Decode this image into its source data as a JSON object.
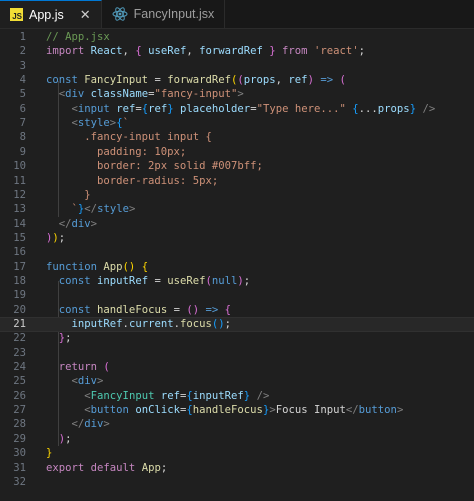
{
  "tabs": [
    {
      "label": "App.js",
      "icon": "js-file-icon",
      "badge": "JS",
      "active": true
    },
    {
      "label": "FancyInput.jsx",
      "icon": "react-icon",
      "active": false
    }
  ],
  "accent": "#0078d4",
  "code_lines": [
    {
      "n": "1",
      "tokens": [
        [
          "// App.jsx",
          "t-com"
        ]
      ]
    },
    {
      "n": "2",
      "tokens": [
        [
          "import ",
          "t-ctrl"
        ],
        [
          "React",
          "t-var"
        ],
        [
          ", ",
          "t-pun"
        ],
        [
          "{ ",
          "t-b2"
        ],
        [
          "useRef",
          "t-var"
        ],
        [
          ", ",
          "t-pun"
        ],
        [
          "forwardRef",
          "t-var"
        ],
        [
          " }",
          "t-b2"
        ],
        [
          " from ",
          "t-ctrl"
        ],
        [
          "'react'",
          "t-str"
        ],
        [
          ";",
          "t-pun"
        ]
      ]
    },
    {
      "n": "3",
      "tokens": []
    },
    {
      "n": "4",
      "tokens": [
        [
          "const ",
          "t-key"
        ],
        [
          "FancyInput",
          "t-fn"
        ],
        [
          " = ",
          "t-pun"
        ],
        [
          "forwardRef",
          "t-fn"
        ],
        [
          "(",
          "t-b1"
        ],
        [
          "(",
          "t-b2"
        ],
        [
          "props",
          "t-var"
        ],
        [
          ", ",
          "t-pun"
        ],
        [
          "ref",
          "t-var"
        ],
        [
          ")",
          "t-b2"
        ],
        [
          " => ",
          "t-key"
        ],
        [
          "(",
          "t-b2"
        ]
      ]
    },
    {
      "n": "5",
      "tokens": [
        [
          "  ",
          "t-pun"
        ],
        [
          "<",
          "t-brk"
        ],
        [
          "div ",
          "t-tag"
        ],
        [
          "className",
          "t-attr"
        ],
        [
          "=",
          "t-pun"
        ],
        [
          "\"fancy-input\"",
          "t-str"
        ],
        [
          ">",
          "t-brk"
        ]
      ]
    },
    {
      "n": "6",
      "tokens": [
        [
          "    ",
          "t-pun"
        ],
        [
          "<",
          "t-brk"
        ],
        [
          "input ",
          "t-tag"
        ],
        [
          "ref",
          "t-attr"
        ],
        [
          "=",
          "t-pun"
        ],
        [
          "{",
          "t-b3"
        ],
        [
          "ref",
          "t-var"
        ],
        [
          "}",
          "t-b3"
        ],
        [
          " placeholder",
          "t-attr"
        ],
        [
          "=",
          "t-pun"
        ],
        [
          "\"Type here...\"",
          "t-str"
        ],
        [
          " ",
          "t-pun"
        ],
        [
          "{",
          "t-b3"
        ],
        [
          "...",
          "t-pun"
        ],
        [
          "props",
          "t-var"
        ],
        [
          "}",
          "t-b3"
        ],
        [
          " />",
          "t-brk"
        ]
      ]
    },
    {
      "n": "7",
      "tokens": [
        [
          "    ",
          "t-pun"
        ],
        [
          "<",
          "t-brk"
        ],
        [
          "style",
          "t-tag"
        ],
        [
          ">",
          "t-brk"
        ],
        [
          "{",
          "t-b3"
        ],
        [
          "`",
          "t-str"
        ]
      ]
    },
    {
      "n": "8",
      "tokens": [
        [
          "      .fancy-input input {",
          "t-css"
        ]
      ]
    },
    {
      "n": "9",
      "tokens": [
        [
          "        padding: 10px;",
          "t-css"
        ]
      ]
    },
    {
      "n": "10",
      "tokens": [
        [
          "        border: 2px solid #007bff;",
          "t-css"
        ]
      ]
    },
    {
      "n": "11",
      "tokens": [
        [
          "        border-radius: 5px;",
          "t-css"
        ]
      ]
    },
    {
      "n": "12",
      "tokens": [
        [
          "      }",
          "t-css"
        ]
      ]
    },
    {
      "n": "13",
      "tokens": [
        [
          "    ",
          "t-pun"
        ],
        [
          "`",
          "t-str"
        ],
        [
          "}",
          "t-b3"
        ],
        [
          "</",
          "t-brk"
        ],
        [
          "style",
          "t-tag"
        ],
        [
          ">",
          "t-brk"
        ]
      ]
    },
    {
      "n": "14",
      "tokens": [
        [
          "  ",
          "t-pun"
        ],
        [
          "</",
          "t-brk"
        ],
        [
          "div",
          "t-tag"
        ],
        [
          ">",
          "t-brk"
        ]
      ]
    },
    {
      "n": "15",
      "tokens": [
        [
          ")",
          "t-b2"
        ],
        [
          ")",
          "t-b1"
        ],
        [
          ";",
          "t-pun"
        ]
      ]
    },
    {
      "n": "16",
      "tokens": []
    },
    {
      "n": "17",
      "tokens": [
        [
          "function ",
          "t-key"
        ],
        [
          "App",
          "t-fn"
        ],
        [
          "()",
          "t-b1"
        ],
        [
          " ",
          "t-pun"
        ],
        [
          "{",
          "t-b1"
        ]
      ]
    },
    {
      "n": "18",
      "tokens": [
        [
          "  ",
          "t-pun"
        ],
        [
          "const ",
          "t-key"
        ],
        [
          "inputRef",
          "t-var"
        ],
        [
          " = ",
          "t-pun"
        ],
        [
          "useRef",
          "t-fn"
        ],
        [
          "(",
          "t-b2"
        ],
        [
          "null",
          "t-key"
        ],
        [
          ")",
          "t-b2"
        ],
        [
          ";",
          "t-pun"
        ]
      ]
    },
    {
      "n": "19",
      "tokens": []
    },
    {
      "n": "20",
      "tokens": [
        [
          "  ",
          "t-pun"
        ],
        [
          "const ",
          "t-key"
        ],
        [
          "handleFocus",
          "t-fn"
        ],
        [
          " = ",
          "t-pun"
        ],
        [
          "()",
          "t-b2"
        ],
        [
          " => ",
          "t-key"
        ],
        [
          "{",
          "t-b2"
        ]
      ]
    },
    {
      "n": "21",
      "tokens": [
        [
          "    ",
          "t-pun"
        ],
        [
          "inputRef",
          "t-var"
        ],
        [
          ".",
          "t-pun"
        ],
        [
          "current",
          "t-var"
        ],
        [
          ".",
          "t-pun"
        ],
        [
          "focus",
          "t-fn"
        ],
        [
          "()",
          "t-b3"
        ],
        [
          ";",
          "t-pun"
        ]
      ]
    },
    {
      "n": "22",
      "tokens": [
        [
          "  ",
          "t-pun"
        ],
        [
          "}",
          "t-b2"
        ],
        [
          ";",
          "t-pun"
        ]
      ]
    },
    {
      "n": "23",
      "tokens": []
    },
    {
      "n": "24",
      "tokens": [
        [
          "  ",
          "t-pun"
        ],
        [
          "return ",
          "t-ctrl"
        ],
        [
          "(",
          "t-b2"
        ]
      ]
    },
    {
      "n": "25",
      "tokens": [
        [
          "    ",
          "t-pun"
        ],
        [
          "<",
          "t-brk"
        ],
        [
          "div",
          "t-tag"
        ],
        [
          ">",
          "t-brk"
        ]
      ]
    },
    {
      "n": "26",
      "tokens": [
        [
          "      ",
          "t-pun"
        ],
        [
          "<",
          "t-brk"
        ],
        [
          "FancyInput ",
          "t-cmp"
        ],
        [
          "ref",
          "t-attr"
        ],
        [
          "=",
          "t-pun"
        ],
        [
          "{",
          "t-b3"
        ],
        [
          "inputRef",
          "t-var"
        ],
        [
          "}",
          "t-b3"
        ],
        [
          " />",
          "t-brk"
        ]
      ]
    },
    {
      "n": "27",
      "tokens": [
        [
          "      ",
          "t-pun"
        ],
        [
          "<",
          "t-brk"
        ],
        [
          "button ",
          "t-tag"
        ],
        [
          "onClick",
          "t-attr"
        ],
        [
          "=",
          "t-pun"
        ],
        [
          "{",
          "t-b3"
        ],
        [
          "handleFocus",
          "t-fn"
        ],
        [
          "}",
          "t-b3"
        ],
        [
          ">",
          "t-brk"
        ],
        [
          "Focus Input",
          "t-pun"
        ],
        [
          "</",
          "t-brk"
        ],
        [
          "button",
          "t-tag"
        ],
        [
          ">",
          "t-brk"
        ]
      ]
    },
    {
      "n": "28",
      "tokens": [
        [
          "    ",
          "t-pun"
        ],
        [
          "</",
          "t-brk"
        ],
        [
          "div",
          "t-tag"
        ],
        [
          ">",
          "t-brk"
        ]
      ]
    },
    {
      "n": "29",
      "tokens": [
        [
          "  ",
          "t-pun"
        ],
        [
          ")",
          "t-b2"
        ],
        [
          ";",
          "t-pun"
        ]
      ]
    },
    {
      "n": "30",
      "tokens": [
        [
          "}",
          "t-b1"
        ]
      ]
    },
    {
      "n": "31",
      "tokens": [
        [
          "export ",
          "t-ctrl"
        ],
        [
          "default ",
          "t-ctrl"
        ],
        [
          "App",
          "t-fn"
        ],
        [
          ";",
          "t-pun"
        ]
      ]
    },
    {
      "n": "32",
      "tokens": []
    }
  ],
  "current_line": "21"
}
